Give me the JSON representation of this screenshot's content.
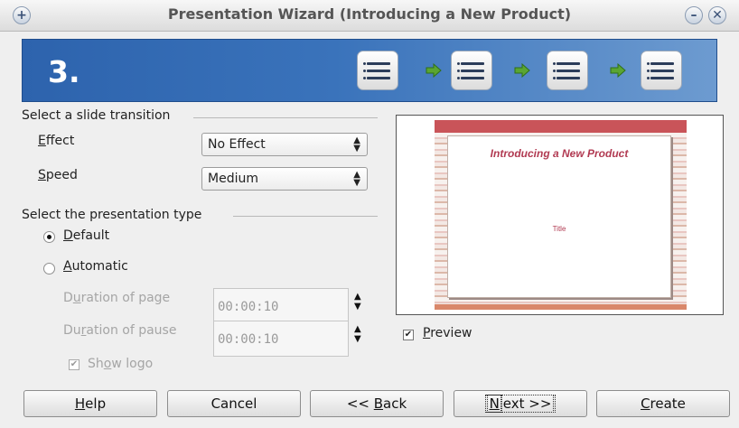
{
  "window": {
    "title": "Presentation Wizard (Introducing a New Product)"
  },
  "banner": {
    "step_number": "3."
  },
  "transition": {
    "group_label": "Select a slide transition",
    "effect_label_u": "E",
    "effect_label_rest": "ffect",
    "effect_value": "No Effect",
    "speed_label_u": "S",
    "speed_label_rest": "peed",
    "speed_value": "Medium"
  },
  "type": {
    "group_label": "Select the presentation type",
    "default_label_u": "D",
    "default_label_rest": "efault",
    "automatic_label_u": "A",
    "automatic_label_rest": "utomatic",
    "duration_page_a": "D",
    "duration_page_u": "u",
    "duration_page_b": "ration of page",
    "duration_page_value": "00:00:10",
    "duration_pause_a": "Du",
    "duration_pause_u": "r",
    "duration_pause_b": "ation of pause",
    "duration_pause_value": "00:00:10",
    "show_logo_a": "Sh",
    "show_logo_u": "o",
    "show_logo_b": "w logo"
  },
  "preview": {
    "slide_title": "Introducing a New Product",
    "slide_subtitle": "Title",
    "checkbox_label_u": "P",
    "checkbox_label_rest": "review",
    "checked": true
  },
  "buttons": {
    "help_u": "H",
    "help_rest": "elp",
    "cancel": "Cancel",
    "back_a": "<< ",
    "back_u": "B",
    "back_b": "ack",
    "next_u": "N",
    "next_rest": "ext >>",
    "create_u": "C",
    "create_rest": "reate"
  },
  "icons": {
    "titlebar_menu": "plus-icon",
    "minimize": "minimize-icon",
    "close": "close-icon",
    "steps": "list-icon",
    "step_arrow": "arrow-right-icon"
  },
  "colors": {
    "banner": "#2d63ad",
    "step_arrow": "#5aa532",
    "slide_accent": "#c95459",
    "slide_text": "#b13a52"
  }
}
